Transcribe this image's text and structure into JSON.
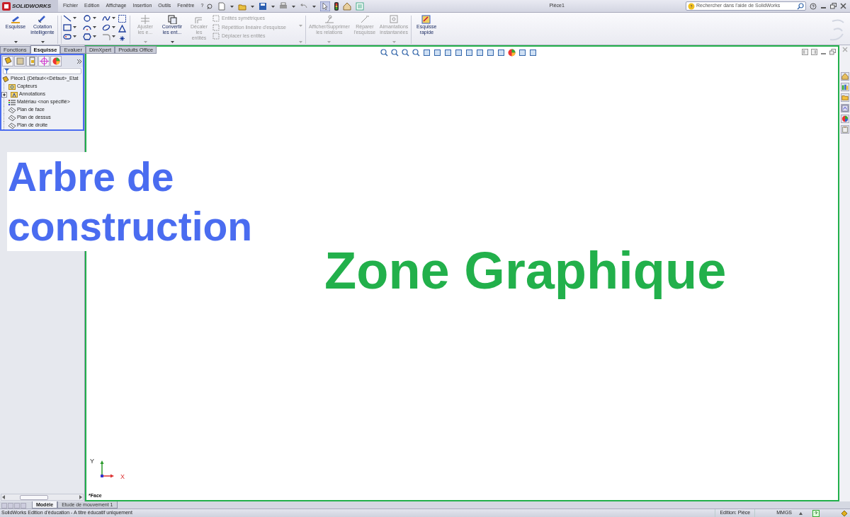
{
  "title_bar": {
    "logo": "SOLIDWORKS",
    "menu": [
      "Fichier",
      "Edition",
      "Affichage",
      "Insertion",
      "Outils",
      "Fenêtre",
      "?"
    ],
    "document_title": "Pièce1",
    "search": {
      "placeholder": "Rechercher dans l'aide de SolidWorks"
    }
  },
  "ribbon": {
    "tools": [
      {
        "kind": "large",
        "label": "Esquisse",
        "disabled": false,
        "menu": true
      },
      {
        "kind": "large",
        "label": "Cotation intelligente",
        "disabled": false,
        "menu": true
      },
      {
        "kind": "grid"
      },
      {
        "kind": "large",
        "label": "Ajuster les e...",
        "disabled": true,
        "menu": true
      },
      {
        "kind": "large",
        "label": "Convertir les ent...",
        "disabled": false,
        "menu": true
      },
      {
        "kind": "large",
        "label": "Décaler les entités",
        "disabled": true,
        "menu": false
      },
      {
        "kind": "stack",
        "items": [
          {
            "label": "Entités symétriques",
            "disabled": true
          },
          {
            "label": "Répétition linéaire d'esquisse",
            "disabled": true
          },
          {
            "label": "Déplacer les entités",
            "disabled": true
          }
        ]
      },
      {
        "kind": "large",
        "label": "Afficher/Supprimer les relations",
        "disabled": true,
        "menu": true
      },
      {
        "kind": "large",
        "label": "Réparer l'esquisse",
        "disabled": true,
        "menu": false
      },
      {
        "kind": "large",
        "label": "Aimantations instantanées",
        "disabled": true,
        "menu": true
      },
      {
        "kind": "large",
        "label": "Esquisse rapide",
        "disabled": false,
        "menu": false
      }
    ]
  },
  "command_tabs": [
    {
      "label": "Fonctions",
      "selected": false
    },
    {
      "label": "Esquisse",
      "selected": true
    },
    {
      "label": "Evaluer",
      "selected": false
    },
    {
      "label": "DimXpert",
      "selected": false
    },
    {
      "label": "Produits Office",
      "selected": false
    }
  ],
  "feature_tree": {
    "root": "Pièce1  (Défaut<<Défaut>_Etat",
    "items": [
      {
        "kind": "sensors",
        "label": "Capteurs"
      },
      {
        "kind": "annotations",
        "label": "Annotations",
        "expanded": false
      },
      {
        "kind": "material",
        "label": "Matériau <non spécifié>"
      },
      {
        "kind": "plane",
        "label": "Plan de face"
      },
      {
        "kind": "plane",
        "label": "Plan de dessus"
      },
      {
        "kind": "plane",
        "label": "Plan de droite"
      }
    ]
  },
  "callouts": [
    {
      "kind": "tree",
      "text": "Arbre de construction",
      "color": "#4a6cf0"
    },
    {
      "kind": "graphics",
      "text": "Zone Graphique",
      "color": "#22b04b"
    }
  ],
  "viewport": {
    "view_label": "*Face",
    "triad": {
      "y": "Y",
      "x": "X"
    }
  },
  "bottom_tabs": [
    {
      "label": "Modèle",
      "selected": true
    },
    {
      "label": "Etude de mouvement 1",
      "selected": false
    }
  ],
  "status_bar": {
    "message": "SolidWorks Edition d'éducation - A titre éducatif uniquement",
    "mode": "Edition: Pièce",
    "units": "MMGS"
  }
}
